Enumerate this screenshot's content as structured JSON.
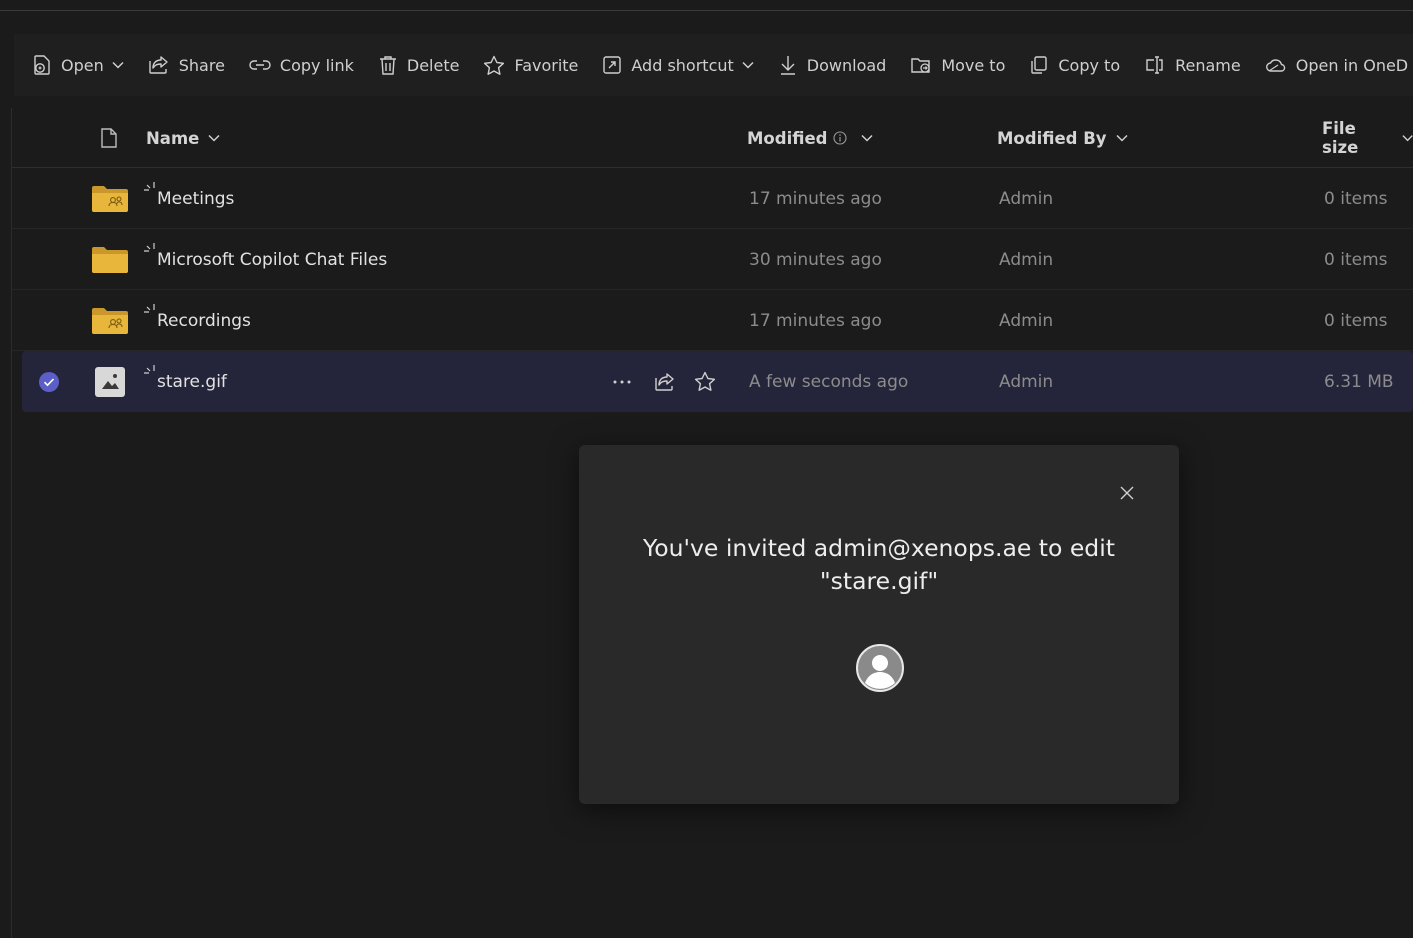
{
  "toolbar": {
    "open": "Open",
    "share": "Share",
    "copy_link": "Copy link",
    "delete": "Delete",
    "favorite": "Favorite",
    "add_shortcut": "Add shortcut",
    "download": "Download",
    "move_to": "Move to",
    "copy_to": "Copy to",
    "rename": "Rename",
    "open_in_onedrive": "Open in OneD"
  },
  "columns": {
    "name": "Name",
    "modified": "Modified",
    "modified_by": "Modified By",
    "file_size": "File size"
  },
  "rows": [
    {
      "name": "Meetings",
      "modified": "17 minutes ago",
      "modified_by": "Admin",
      "size": "0 items",
      "icon": "shared-folder-icon"
    },
    {
      "name": "Microsoft Copilot Chat Files",
      "modified": "30 minutes ago",
      "modified_by": "Admin",
      "size": "0 items",
      "icon": "folder-icon"
    },
    {
      "name": "Recordings",
      "modified": "17 minutes ago",
      "modified_by": "Admin",
      "size": "0 items",
      "icon": "shared-folder-icon"
    },
    {
      "name": "stare.gif",
      "modified": "A few seconds ago",
      "modified_by": "Admin",
      "size": "6.31 MB",
      "icon": "image-file-icon",
      "selected": true
    }
  ],
  "dialog": {
    "message": "You've invited admin@xenops.ae to edit \"stare.gif\""
  },
  "colors": {
    "background": "#1b1b1b",
    "selected_row": "#24243a",
    "accent": "#5b5fc7",
    "folder": "#e8b63a"
  }
}
